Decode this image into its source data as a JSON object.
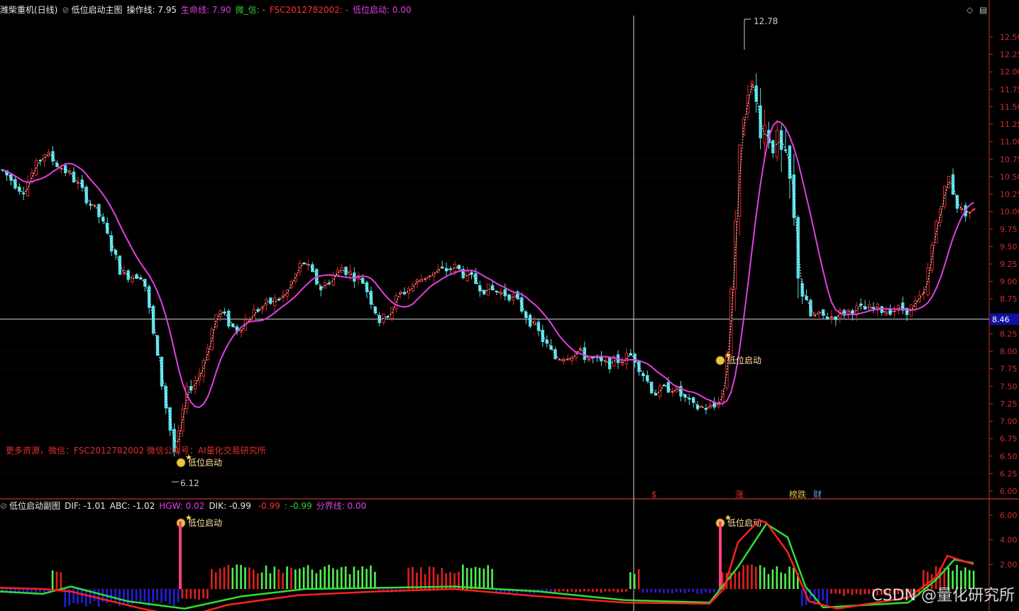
{
  "main_header": {
    "stock_name": "潍柴重机(日线)",
    "indicator_name": "低位启动主图",
    "fields": [
      {
        "label": "操作线:",
        "value": "7.95",
        "color": "#e8e8e8"
      },
      {
        "label": "生命线:",
        "value": "7.90",
        "color": "#e040e0"
      },
      {
        "label": "微_信:",
        "value": "-",
        "color": "#30d030"
      },
      {
        "label": "FSC2012782002:",
        "value": "-",
        "color": "#ff3030"
      },
      {
        "label": "低位启动:",
        "value": "0.00",
        "color": "#e040e0"
      }
    ]
  },
  "sub_header": {
    "indicator_name": "低位启动副图",
    "fields": [
      {
        "label": "DIF:",
        "value": "-1.01",
        "color": "#e8e8e8"
      },
      {
        "label": "ABC:",
        "value": "-1.02",
        "color": "#e8e8e8"
      },
      {
        "label": "HGW:",
        "value": "0.02",
        "color": "#e040e0"
      },
      {
        "label": "DIK:",
        "value": "-0.99",
        "color": "#e8e8e8"
      },
      {
        "label": "",
        "value": "-0.99",
        "color": "#ff3030"
      },
      {
        "label": ":",
        "value": "-0.99",
        "color": "#30d030"
      },
      {
        "label": "分界线:",
        "value": "0.00",
        "color": "#e040e0"
      }
    ]
  },
  "controls": {
    "diamond": "◇",
    "menu": "▤"
  },
  "price_axis": {
    "ticks": [
      "12.50",
      "12.25",
      "12.00",
      "11.75",
      "11.50",
      "11.25",
      "11.00",
      "10.75",
      "10.50",
      "10.25",
      "10.00",
      "9.75",
      "9.50",
      "9.25",
      "9.00",
      "8.75",
      "8.25",
      "8.00",
      "7.75",
      "7.50",
      "7.25",
      "7.00",
      "6.75",
      "6.50",
      "6.25",
      "6.00"
    ],
    "current_price_label": "8.46"
  },
  "sub_axis": {
    "ticks": [
      "6.00",
      "4.00",
      "2.00"
    ]
  },
  "annotations": {
    "high_label": "12.78",
    "low_label": "6.12",
    "signal_label": "低位启动",
    "promo_text": "更多资源，微信：FSC2012782002 微信公众号：AI量化交易研究所",
    "event_marks": [
      "$",
      "涨",
      "榜跌",
      "财"
    ]
  },
  "watermark": "CSDN @量化研究所",
  "colors": {
    "up": "#e02828",
    "down": "#54e0e8",
    "ma": "#e040e0",
    "line": "#ffffff",
    "green": "#30e030",
    "blue": "#2020e0",
    "axis": "#c03030",
    "grid": "#600000"
  },
  "chart_data": {
    "type": "candlestick",
    "ylim": [
      6.0,
      12.8
    ],
    "high": 12.78,
    "low": 6.12,
    "current": 8.46
  }
}
